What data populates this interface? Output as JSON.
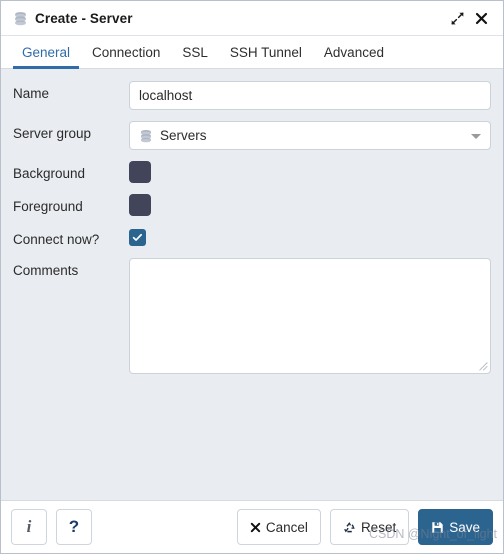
{
  "window": {
    "title": "Create - Server",
    "title_icon": "server-stack-icon",
    "expand_icon": "expand-diagonal-icon",
    "close_icon": "close-icon"
  },
  "tabs": [
    {
      "label": "General",
      "active": true
    },
    {
      "label": "Connection",
      "active": false
    },
    {
      "label": "SSL",
      "active": false
    },
    {
      "label": "SSH Tunnel",
      "active": false
    },
    {
      "label": "Advanced",
      "active": false
    }
  ],
  "form": {
    "name": {
      "label": "Name",
      "value": "localhost",
      "placeholder": ""
    },
    "server_group": {
      "label": "Server group",
      "value": "Servers",
      "icon": "server-stack-icon",
      "caret": "chevron-down-icon"
    },
    "background": {
      "label": "Background",
      "color": "#424559"
    },
    "foreground": {
      "label": "Foreground",
      "color": "#424559"
    },
    "connect_now": {
      "label": "Connect now?",
      "checked": true,
      "color": "#2c6490"
    },
    "comments": {
      "label": "Comments",
      "value": "",
      "placeholder": ""
    }
  },
  "footer": {
    "info_label": "i",
    "help_label": "?",
    "cancel_label": "Cancel",
    "reset_label": "Reset",
    "save_label": "Save",
    "cancel_icon": "close-x-icon",
    "reset_icon": "recycle-icon",
    "save_icon": "floppy-disk-icon"
  },
  "watermark": {
    "text": "CSDN @Night_of_light"
  },
  "colors": {
    "accent": "#2c6490",
    "tab_active": "#2f6ca8",
    "form_bg": "#e9ecf1",
    "swatch": "#424559"
  }
}
